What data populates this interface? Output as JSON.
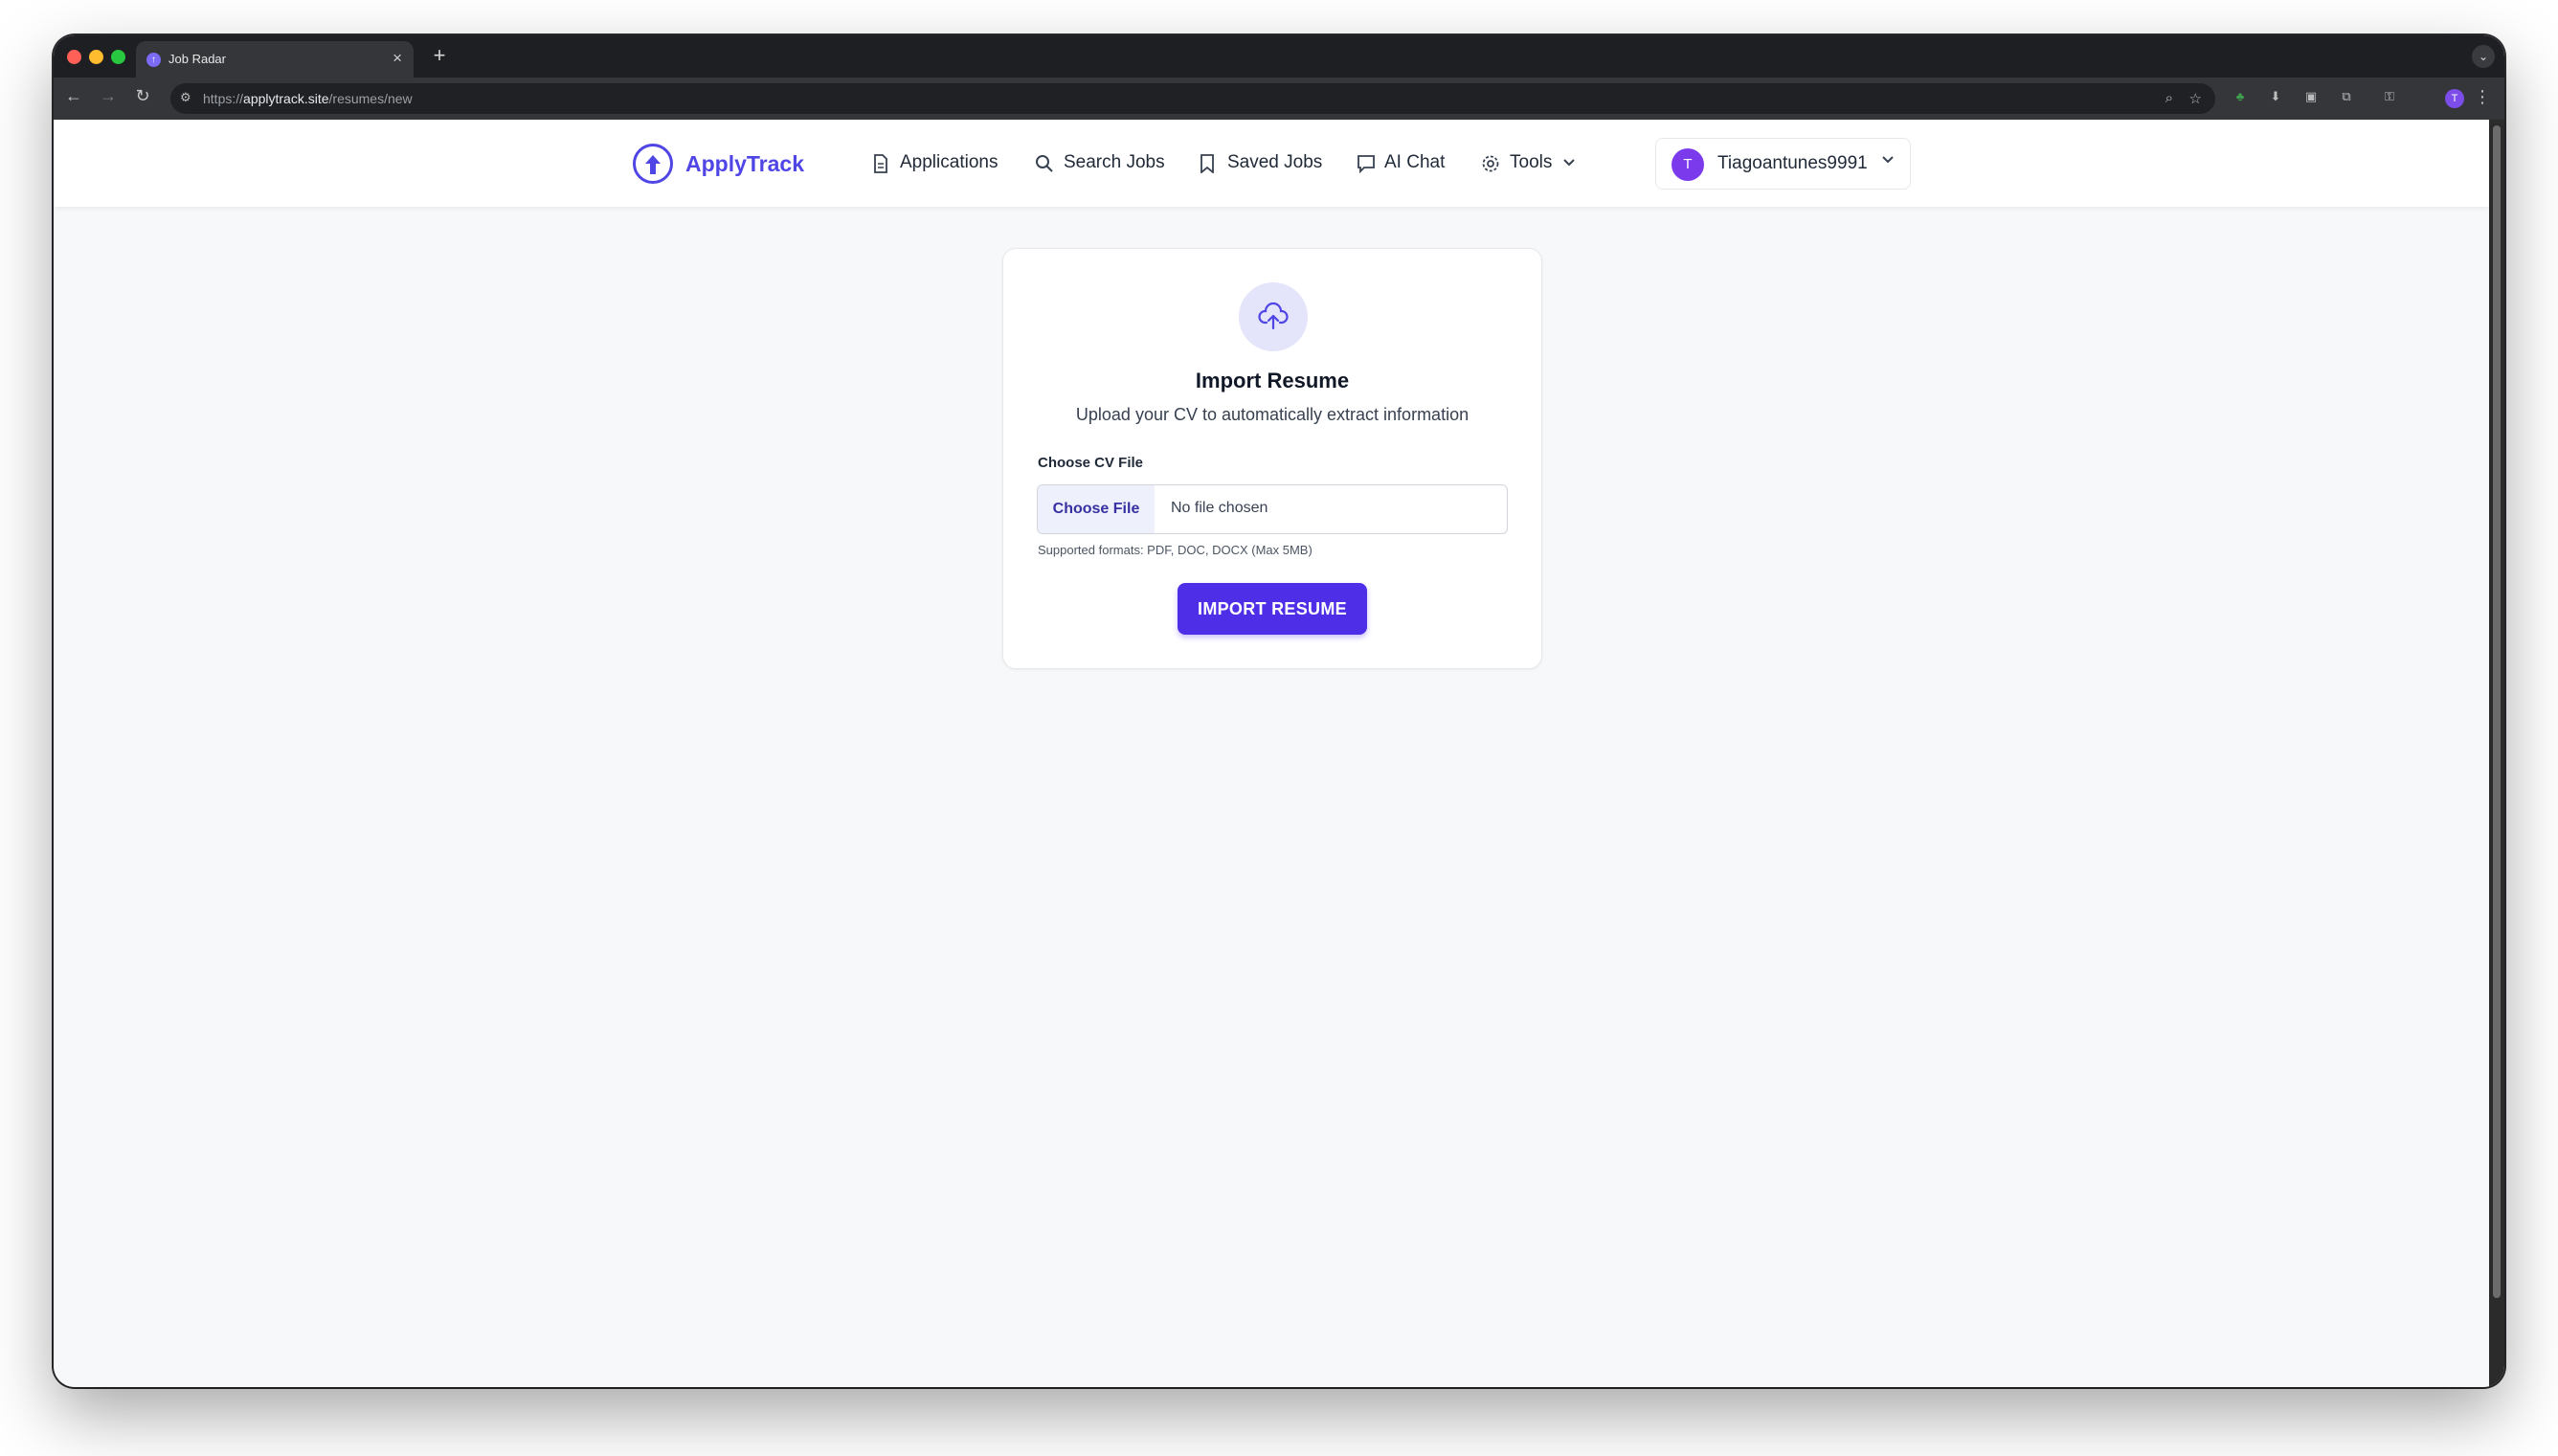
{
  "browser": {
    "tab_title": "Job Radar",
    "new_tab_symbol": "+",
    "tab_close_symbol": "×",
    "favicon_letter": "↑",
    "url_scheme": "https://",
    "url_host": "applytrack.site",
    "url_path": "/resumes/new",
    "profile_initial": "T"
  },
  "app": {
    "brand": "ApplyTrack",
    "brand_color": "#4f46e5",
    "nav": {
      "applications": "Applications",
      "search_jobs": "Search Jobs",
      "saved_jobs": "Saved Jobs",
      "ai_chat": "AI Chat",
      "tools": "Tools"
    },
    "user": {
      "initial": "T",
      "name": "Tiagoantunes9991",
      "avatar_color": "#7c3aed"
    }
  },
  "card": {
    "title": "Import Resume",
    "subtitle": "Upload your CV to automatically extract information",
    "field_label": "Choose CV File",
    "choose_file": "Choose File",
    "no_file": "No file chosen",
    "hint": "Supported formats: PDF, DOC, DOCX (Max 5MB)",
    "submit": "IMPORT RESUME",
    "accent": "#4f2ee8"
  }
}
